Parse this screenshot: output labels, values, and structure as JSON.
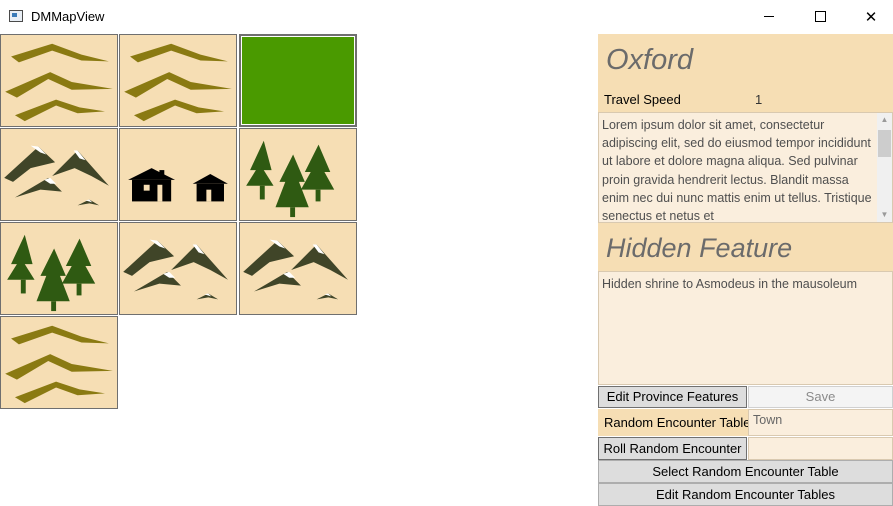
{
  "window": {
    "title": "DMMapView",
    "minimize_glyph": "",
    "maximize_glyph": "",
    "close_glyph": "✕"
  },
  "map": {
    "tiles": [
      {
        "terrain": "hills",
        "selected": false
      },
      {
        "terrain": "hills",
        "selected": false
      },
      {
        "terrain": "grassland",
        "selected": true,
        "color": "#4a9a00"
      },
      {
        "terrain": "mountains",
        "selected": false
      },
      {
        "terrain": "town",
        "selected": false
      },
      {
        "terrain": "forest",
        "selected": false
      },
      {
        "terrain": "forest",
        "selected": false
      },
      {
        "terrain": "mountains",
        "selected": false
      },
      {
        "terrain": "mountains",
        "selected": false
      },
      {
        "terrain": "hills",
        "selected": false
      }
    ],
    "colors": {
      "tile_bg": "#f6deb4",
      "hills": "#8a7a12",
      "mountains": "#404528",
      "forest": "#2f5a12",
      "town": "#000000",
      "grass": "#4a9a00"
    }
  },
  "province": {
    "name": "Oxford",
    "travel_speed_label": "Travel Speed",
    "travel_speed_value": "1",
    "description": "Lorem ipsum dolor sit amet, consectetur adipiscing elit, sed do eiusmod tempor incididunt ut labore et dolore magna aliqua. Sed pulvinar proin gravida hendrerit lectus. Blandit massa enim nec dui nunc mattis enim ut tellus. Tristique senectus et netus et"
  },
  "hidden_feature": {
    "title": "Hidden Feature",
    "text": "Hidden shrine to Asmodeus in the mausoleum"
  },
  "buttons": {
    "edit_province_features": "Edit Province Features",
    "save": "Save",
    "roll_random_encounter": "Roll Random Encounter",
    "select_random_encounter_table": "Select Random Encounter Table",
    "edit_random_encounter_tables": "Edit Random Encounter Tables"
  },
  "random_encounter": {
    "label": "Random Encounter Table",
    "value": "Town",
    "roll_result": ""
  },
  "scrollbar": {
    "up_glyph": "▲",
    "down_glyph": "▼"
  }
}
